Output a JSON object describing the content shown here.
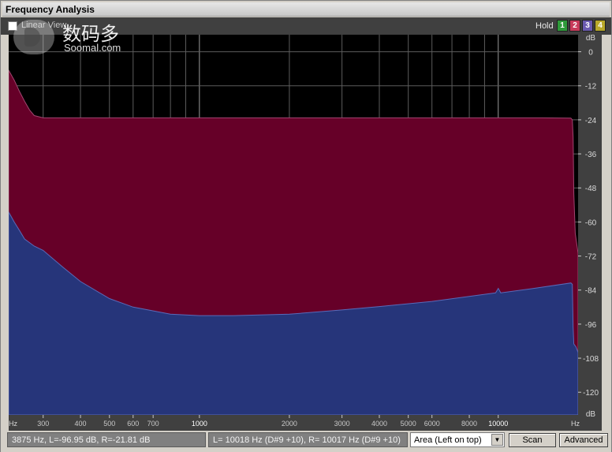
{
  "window": {
    "title": "Frequency Analysis"
  },
  "toolbar": {
    "linear_view_label": "Linear View",
    "linear_view_checked": false,
    "hold_label": "Hold",
    "hold_buttons": [
      "1",
      "2",
      "3",
      "4"
    ]
  },
  "watermark": {
    "cn": "数码多",
    "en": "Soomal.com"
  },
  "chart_data": {
    "type": "area",
    "xlabel": "Hz",
    "ylabel": "dB",
    "xscale": "log",
    "xlim": [
      230,
      18500
    ],
    "ylim": [
      -128,
      6
    ],
    "x_ticks": [
      300,
      400,
      500,
      600,
      700,
      1000,
      2000,
      3000,
      4000,
      5000,
      6000,
      8000,
      10000
    ],
    "x_tick_labels": [
      "300",
      "400",
      "500",
      "600",
      "700",
      "1000",
      "2000",
      "3000",
      "4000",
      "5000",
      "6000",
      "8000",
      "10000"
    ],
    "y_ticks": [
      0,
      -12,
      -24,
      -36,
      -48,
      -60,
      -72,
      -84,
      -96,
      -108,
      -120
    ],
    "y_tick_labels": [
      "0",
      "-12",
      "-24",
      "-36",
      "-48",
      "-60",
      "-72",
      "-84",
      "-96",
      "-108",
      "-120"
    ],
    "grid": true,
    "series": [
      {
        "color": "#660028",
        "x": [
          230,
          240,
          250,
          260,
          270,
          280,
          300,
          400,
          600,
          1000,
          2000,
          4000,
          8000,
          10000,
          14000,
          17500,
          17700,
          17800,
          17900,
          18100,
          18500
        ],
        "y": [
          -6.5,
          -10,
          -14,
          -17.5,
          -20.5,
          -22.5,
          -23.3,
          -23.3,
          -23.3,
          -23.3,
          -23.3,
          -23.3,
          -23.3,
          -23.3,
          -23.3,
          -23.4,
          -24,
          -30,
          -50,
          -64,
          -71
        ]
      },
      {
        "color": "#26357a",
        "x": [
          230,
          240,
          250,
          260,
          280,
          300,
          350,
          400,
          500,
          600,
          800,
          1000,
          1300,
          2000,
          3000,
          4000,
          6000,
          9000,
          9800,
          10000,
          10200,
          13000,
          17500,
          17700,
          17800,
          17900,
          18200,
          18500
        ],
        "y": [
          -56.5,
          -60,
          -63,
          -66,
          -68.5,
          -70,
          -76,
          -81,
          -87,
          -90,
          -92.5,
          -93,
          -93,
          -92.5,
          -91,
          -89.8,
          -88,
          -85.5,
          -85,
          -83.4,
          -85,
          -83.5,
          -81.5,
          -82,
          -97,
          -103,
          -104,
          -106
        ]
      }
    ]
  },
  "status": {
    "cursor_readout": "3875 Hz, L=-96.95 dB, R=-21.81 dB",
    "peak_readout": "L=  10018 Hz (D#9 +10), R=  10017 Hz (D#9 +10)",
    "mode_selected": "Area (Left on top)",
    "scan_label": "Scan",
    "advanced_label": "Advanced"
  }
}
